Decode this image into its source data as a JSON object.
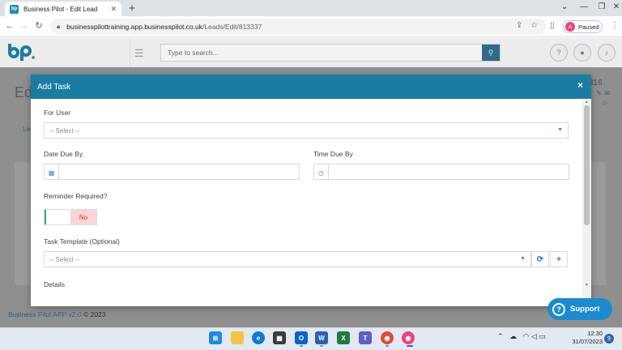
{
  "browser": {
    "tab_title": "Business Pilot - Edit Lead",
    "tab_favicon": "bp",
    "new_tab": "+",
    "url_host": "businesspilottraining.app.businesspilot.co.uk",
    "url_path": "/Leads/Edit/813337",
    "profile_initial": "A",
    "profile_status": "Paused",
    "window_controls": [
      "minimize",
      "maximize",
      "close"
    ]
  },
  "app_header": {
    "search_placeholder": "Type to search...",
    "logo": "bp"
  },
  "background_page": {
    "title_fragment": "Ed",
    "lead_id_fragment": "316",
    "tab_fragment": "Lea",
    "footer_link": "Business Pilot APP v2.0",
    "footer_copy": "© 2023"
  },
  "modal": {
    "title": "Add Task",
    "close": "×",
    "for_user_label": "For User",
    "for_user_value": "-- Select --",
    "date_due_label": "Date Due By",
    "date_due_value": "",
    "time_due_label": "Time Due By",
    "time_due_value": "",
    "reminder_label": "Reminder Required?",
    "reminder_value": "No",
    "template_label": "Task Template (Optional)",
    "template_value": "-- Select --",
    "details_label": "Details"
  },
  "support": {
    "label": "Support"
  },
  "taskbar": {
    "time": "12:30",
    "date": "31/07/2023",
    "notifications": "9",
    "colors": {
      "windows": "#1e88e5",
      "explorer": "#f6c343",
      "edge": "#0d7bd4",
      "store": "#3a3a3a",
      "outlook": "#0a64c8",
      "word": "#2b5fb4",
      "excel": "#1d7a43",
      "teams": "#5b5fc7",
      "chrome": "#e04a3a",
      "chrome_profile": "#e8457a"
    }
  },
  "colors": {
    "modal_header": "#1b7ca3",
    "accent": "#3a8fc4",
    "reminder_no_bg": "#fbd5d5",
    "support": "#1d8ad0"
  }
}
